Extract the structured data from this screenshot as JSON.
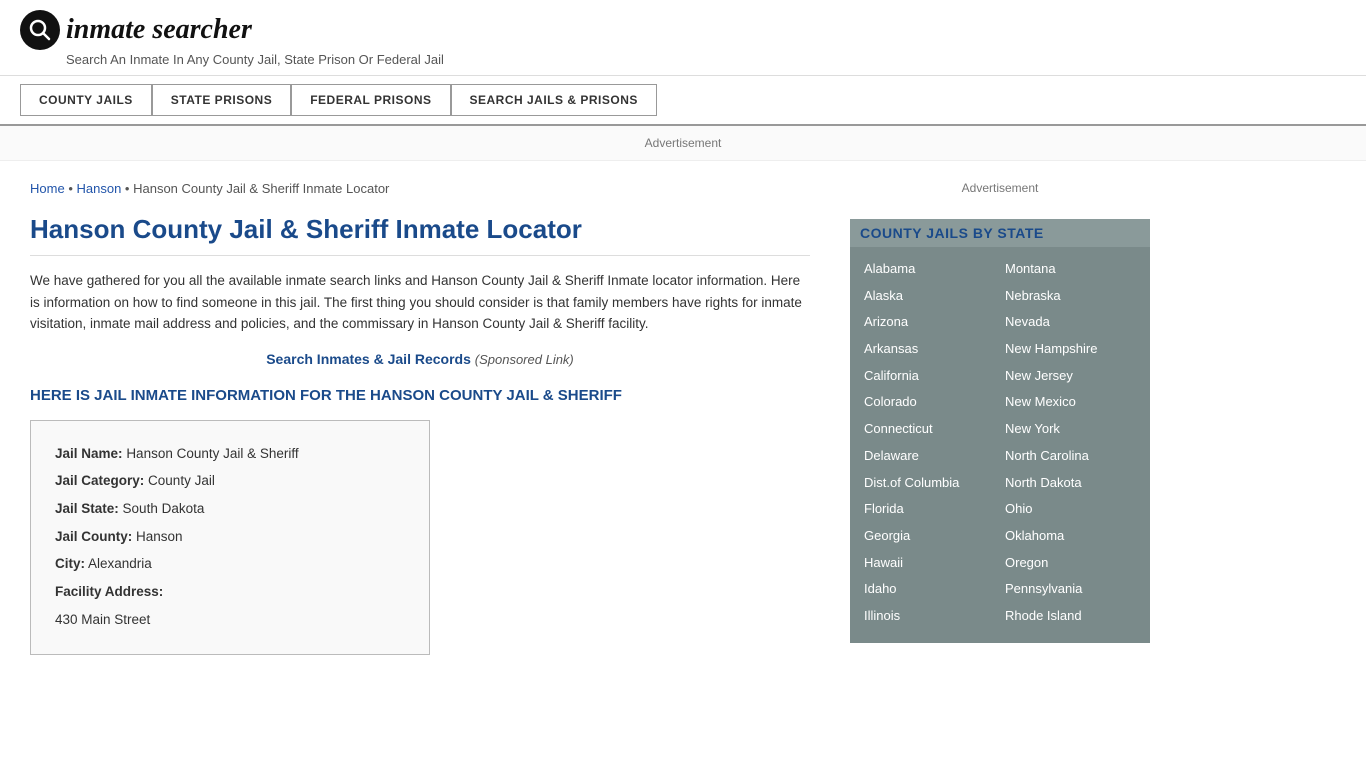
{
  "header": {
    "logo_icon": "🔍",
    "logo_text": "inmate searcher",
    "tagline": "Search An Inmate In Any County Jail, State Prison Or Federal Jail"
  },
  "nav": {
    "items": [
      {
        "label": "COUNTY JAILS"
      },
      {
        "label": "STATE PRISONS"
      },
      {
        "label": "FEDERAL PRISONS"
      },
      {
        "label": "SEARCH JAILS & PRISONS"
      }
    ]
  },
  "ad": {
    "label": "Advertisement"
  },
  "breadcrumb": {
    "home": "Home",
    "separator": "•",
    "parent": "Hanson",
    "current": "Hanson County Jail & Sheriff Inmate Locator"
  },
  "page": {
    "title": "Hanson County Jail & Sheriff Inmate Locator",
    "intro": "We have gathered for you all the available inmate search links and Hanson County Jail & Sheriff Inmate locator information. Here is information on how to find someone in this jail. The first thing you should consider is that family members have rights for inmate visitation, inmate mail address and policies, and the commissary in Hanson County Jail & Sheriff facility.",
    "search_link_text": "Search Inmates & Jail Records",
    "sponsored_text": "(Sponsored Link)",
    "section_heading": "HERE IS JAIL INMATE INFORMATION FOR THE HANSON COUNTY JAIL & SHERIFF"
  },
  "info_box": {
    "jail_name_label": "Jail Name:",
    "jail_name_value": "Hanson County Jail & Sheriff",
    "jail_category_label": "Jail Category:",
    "jail_category_value": "County Jail",
    "jail_state_label": "Jail State:",
    "jail_state_value": "South Dakota",
    "jail_county_label": "Jail County:",
    "jail_county_value": "Hanson",
    "city_label": "City:",
    "city_value": "Alexandria",
    "facility_address_label": "Facility Address:",
    "facility_address_value": "430 Main Street"
  },
  "sidebar": {
    "ad_label": "Advertisement",
    "state_box_title": "COUNTY JAILS BY STATE",
    "states_col1": [
      "Alabama",
      "Alaska",
      "Arizona",
      "Arkansas",
      "California",
      "Colorado",
      "Connecticut",
      "Delaware",
      "Dist.of Columbia",
      "Florida",
      "Georgia",
      "Hawaii",
      "Idaho",
      "Illinois"
    ],
    "states_col2": [
      "Montana",
      "Nebraska",
      "Nevada",
      "New Hampshire",
      "New Jersey",
      "New Mexico",
      "New York",
      "North Carolina",
      "North Dakota",
      "Ohio",
      "Oklahoma",
      "Oregon",
      "Pennsylvania",
      "Rhode Island"
    ]
  }
}
